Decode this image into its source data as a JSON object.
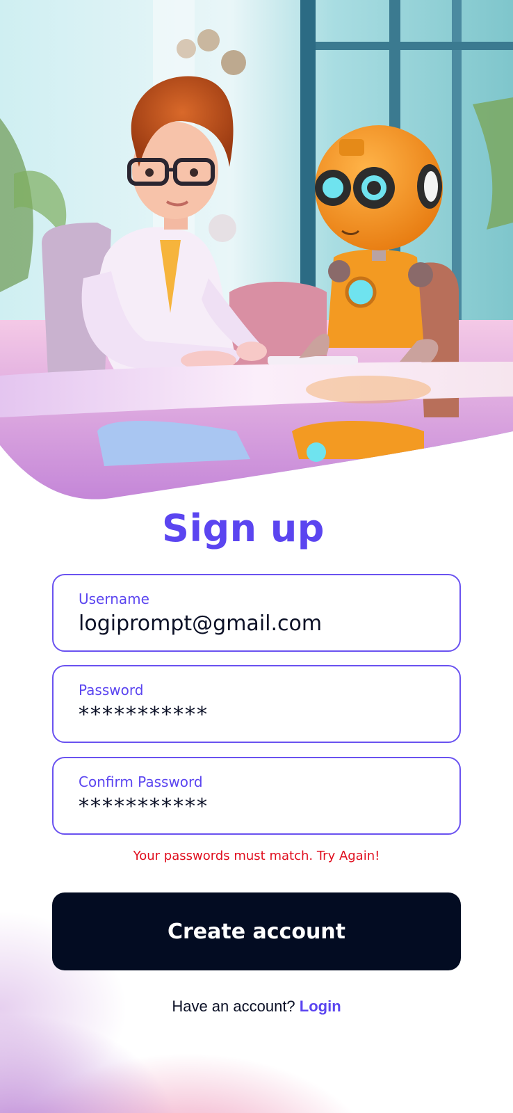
{
  "page": {
    "title": "Sign up"
  },
  "form": {
    "username": {
      "label": "Username",
      "value": "logiprompt@gmail.com"
    },
    "password": {
      "label": "Password",
      "value": "***********"
    },
    "confirm_password": {
      "label": "Confirm Password",
      "value": "***********"
    },
    "error_message": "Your passwords must match. Try Again!",
    "submit_label": "Create account"
  },
  "footer": {
    "prompt": "Have an account? ",
    "login_link": "Login"
  },
  "hero": {
    "icon": "woman-and-robot-illustration"
  },
  "colors": {
    "accent": "#5b45f0",
    "button": "#030c22",
    "error": "#e00f1f",
    "text": "#0b1026"
  }
}
